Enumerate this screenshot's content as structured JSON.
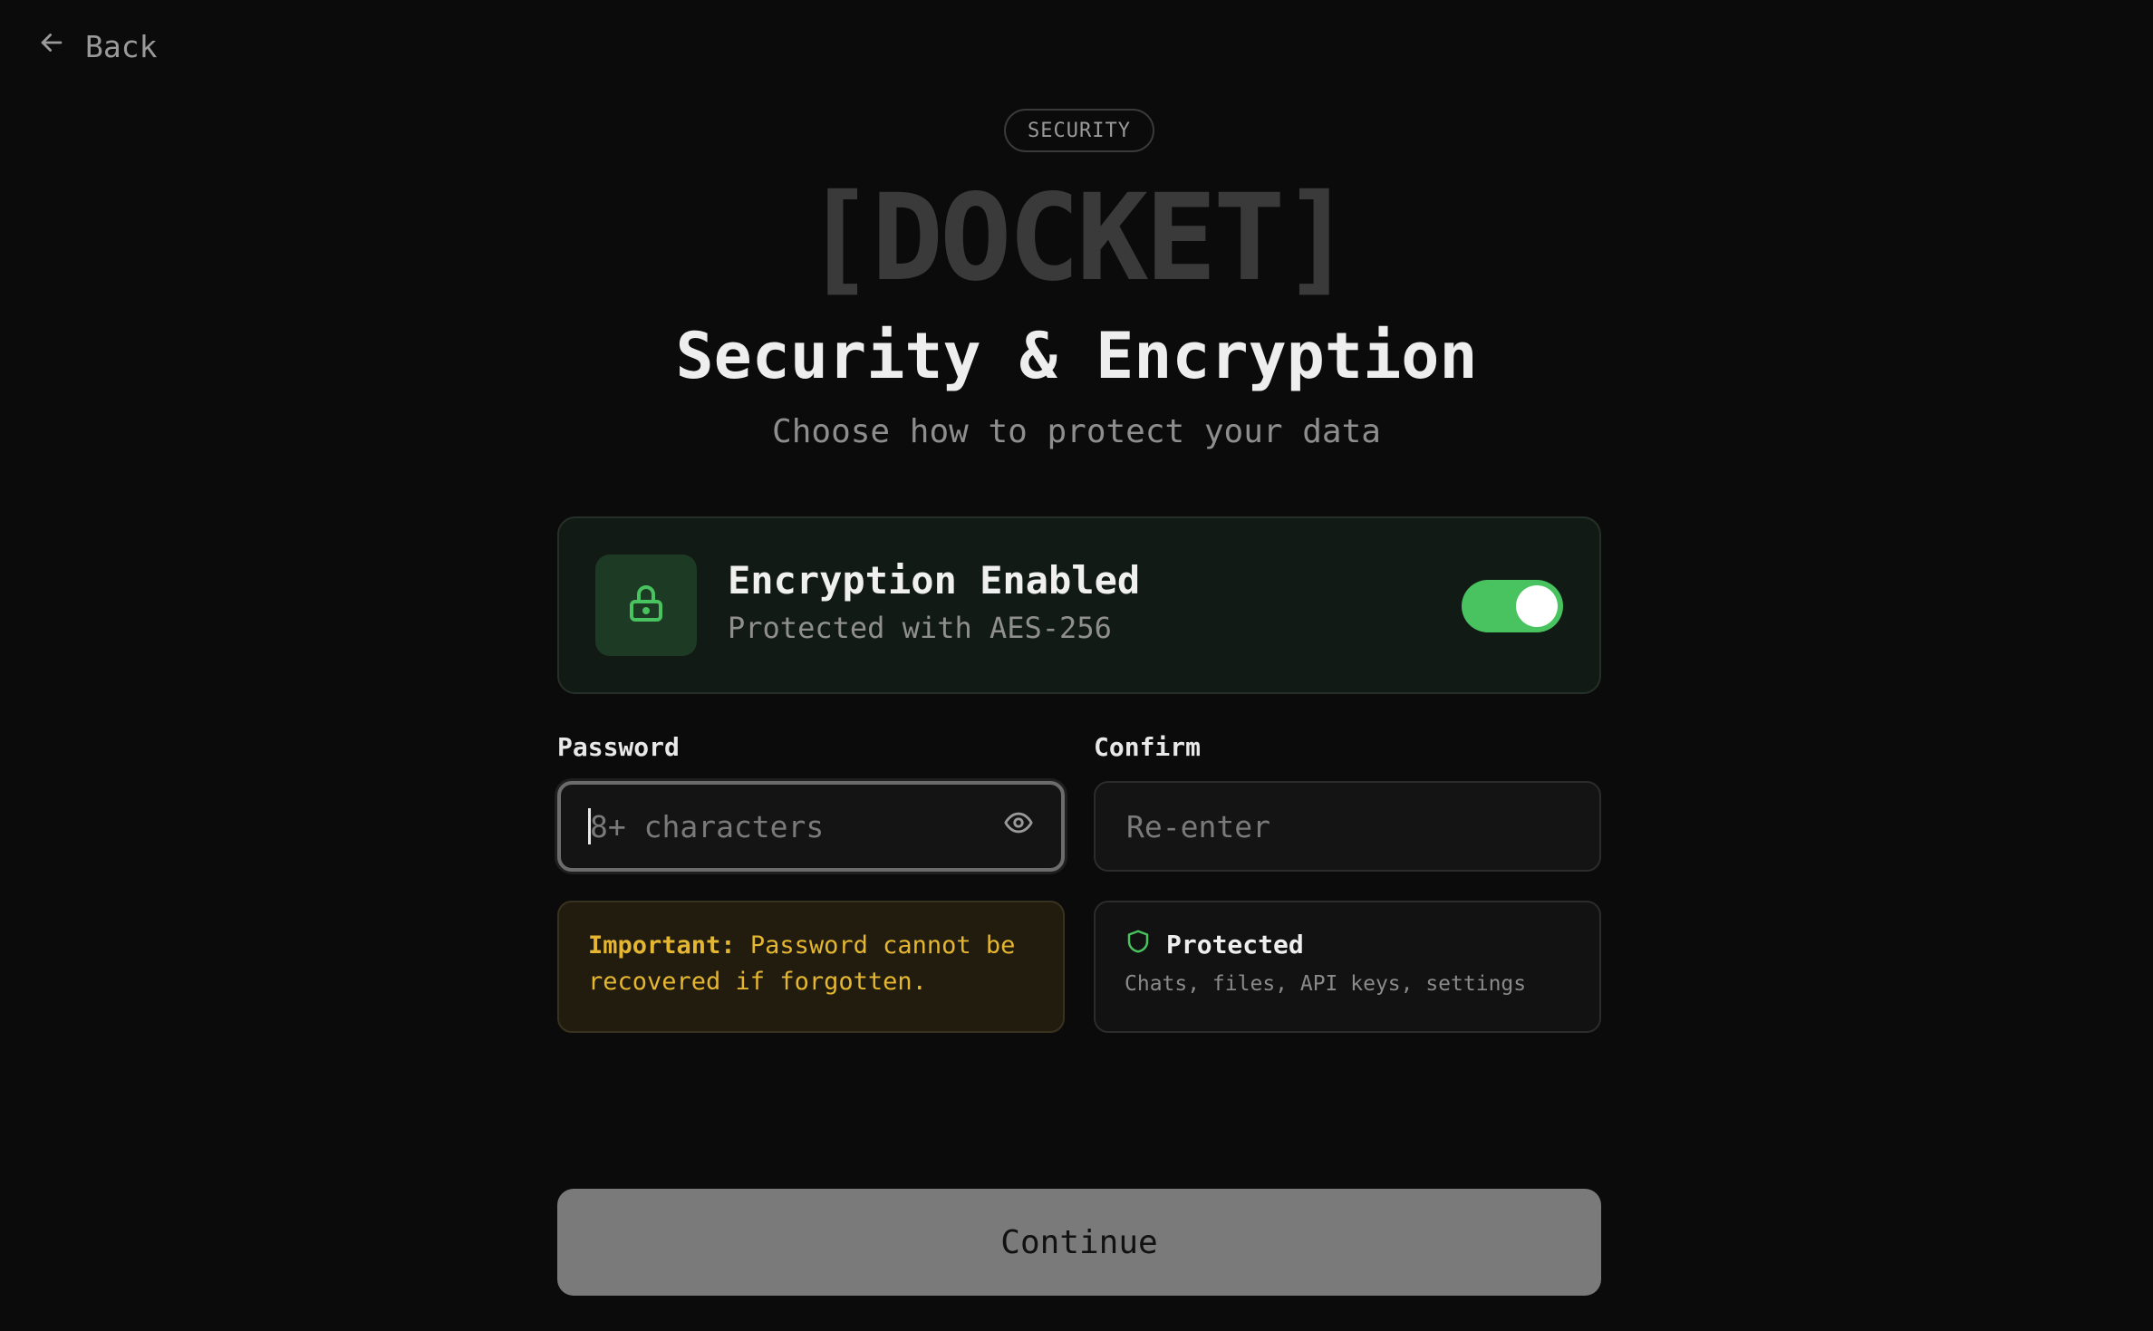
{
  "nav": {
    "back_label": "Back"
  },
  "header": {
    "badge": "SECURITY",
    "logo": "[DOCKET]",
    "title": "Security & Encryption",
    "subtitle": "Choose how to protect your data"
  },
  "encryption": {
    "title": "Encryption Enabled",
    "subtitle": "Protected with AES-256",
    "enabled": true,
    "accent_color": "#48c35f"
  },
  "password": {
    "label": "Password",
    "placeholder": "8+ characters",
    "value": ""
  },
  "confirm": {
    "label": "Confirm",
    "placeholder": "Re-enter",
    "value": ""
  },
  "warning": {
    "prefix": "Important:",
    "text": " Password cannot be recovered if forgotten.",
    "color": "#e4b631"
  },
  "protected_info": {
    "title": "Protected",
    "items": "Chats, files, API keys, settings"
  },
  "actions": {
    "continue_label": "Continue"
  }
}
